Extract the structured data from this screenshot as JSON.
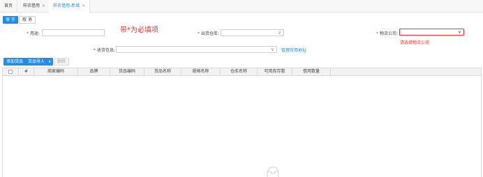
{
  "tabs": [
    {
      "label": "首页",
      "closable": false
    },
    {
      "label": "样衣借用",
      "closable": true
    },
    {
      "label": "样衣借用-新增",
      "closable": true,
      "active": true
    }
  ],
  "close_glyph": "×",
  "toolbar": {
    "save": "保 存",
    "cancel": "取 消"
  },
  "form": {
    "purpose_label": "用途:",
    "warehouse_label": "出货仓库:",
    "logistics_label": "物流公司:",
    "logistics_error": "请选择物流公司",
    "receiver_label": "收货信息:",
    "manage_address_link": "管理常用地址",
    "required_mark": "*",
    "chevron": "∨"
  },
  "annotation": "带*为必填项",
  "goods_toolbar": {
    "add": "添加货品",
    "import": "货品导入",
    "import_chevron": "∨",
    "delete": "删除"
  },
  "table": {
    "columns": [
      "#",
      "商家编码",
      "品牌",
      "货品编码",
      "货品名称",
      "规格名称",
      "仓库名称",
      "可用库存数",
      "借用数量"
    ]
  },
  "colors": {
    "primary": "#1e8ee8",
    "error": "#e53935",
    "border": "#d9d9d9"
  }
}
